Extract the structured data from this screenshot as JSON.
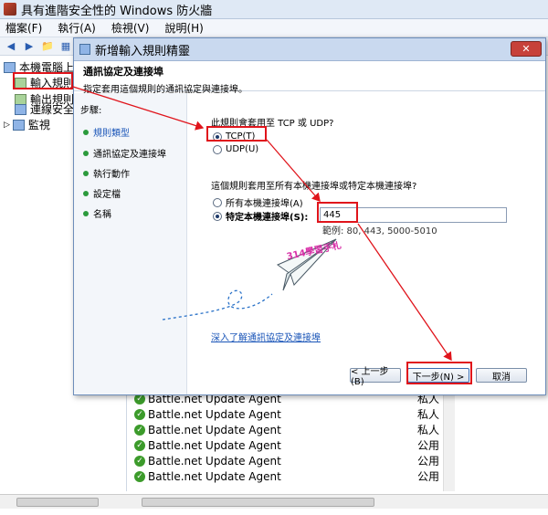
{
  "window": {
    "title": "具有進階安全性的 Windows 防火牆"
  },
  "menu": [
    "檔案(F)",
    "執行(A)",
    "檢視(V)",
    "說明(H)"
  ],
  "tree": {
    "root": "本機電腦上",
    "items": [
      "輸入規則",
      "輸出規則",
      "連線安全",
      "監視"
    ]
  },
  "list": {
    "rows": [
      {
        "name": "Battle.net Update Agent",
        "group": "私人"
      },
      {
        "name": "Battle.net Update Agent",
        "group": "私人"
      },
      {
        "name": "Battle.net Update Agent",
        "group": "私人"
      },
      {
        "name": "Battle.net Update Agent",
        "group": "公用"
      },
      {
        "name": "Battle.net Update Agent",
        "group": "公用"
      },
      {
        "name": "Battle.net Update Agent",
        "group": "公用"
      }
    ]
  },
  "dialog": {
    "title": "新增輸入規則精靈",
    "close_icon": "close-icon",
    "heading": "通訊協定及連接埠",
    "subheading": "指定套用這個規則的通訊協定與連接埠。",
    "steps_label": "步驟:",
    "steps": [
      "規則類型",
      "通訊協定及連接埠",
      "執行動作",
      "設定檔",
      "名稱"
    ],
    "q1": "此規則會套用至 TCP 或 UDP?",
    "tcp_label": "TCP(T)",
    "udp_label": "UDP(U)",
    "q2": "這個規則套用至所有本機連接埠或特定本機連接埠?",
    "all_ports_label": "所有本機連接埠(A)",
    "specific_ports_label": "特定本機連接埠(S):",
    "port_value": "445",
    "port_hint": "範例: 80, 443, 5000-5010",
    "learn_link": "深入了解通訊協定及連接埠",
    "back": "< 上一步(B)",
    "next": "下一步(N) >",
    "cancel": "取消"
  },
  "watermark": "314學習手札",
  "colors": {
    "highlight": "#e0141b",
    "link": "#1a55b8",
    "watermark": "#d92fa8"
  }
}
